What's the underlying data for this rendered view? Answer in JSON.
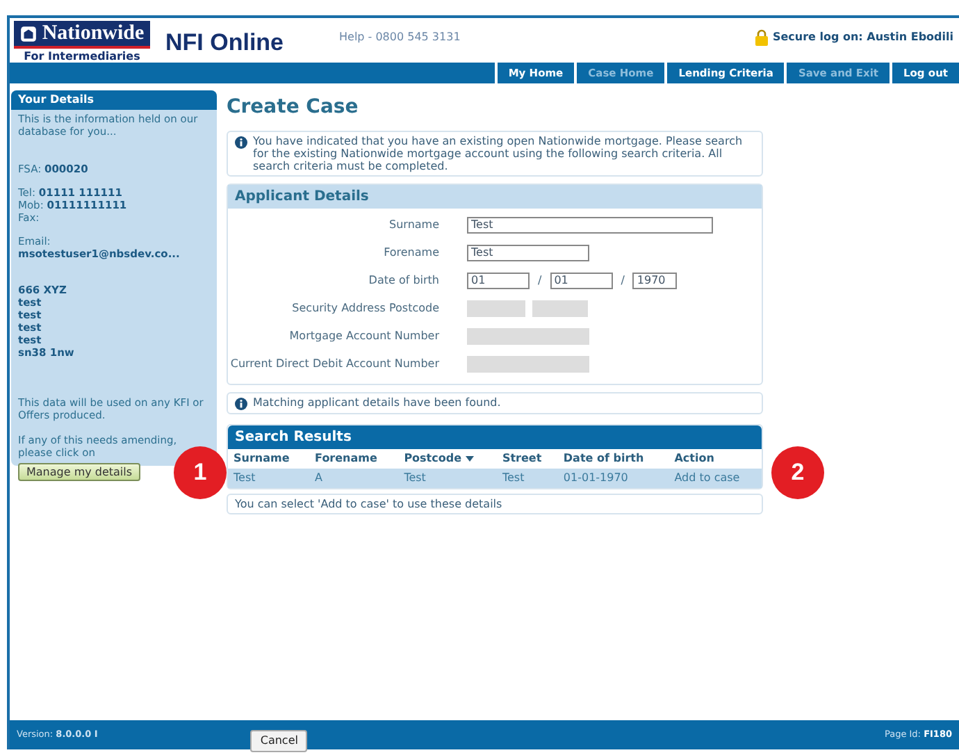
{
  "header": {
    "brand": "Nationwide",
    "subbrand": "For Intermediaries",
    "product": "NFI Online",
    "help": "Help - 0800 545 3131",
    "secure": "Secure log on: Austin Ebodili"
  },
  "nav": [
    {
      "label": "My Home",
      "disabled": false
    },
    {
      "label": "Case Home",
      "disabled": true
    },
    {
      "label": "Lending Criteria",
      "disabled": false
    },
    {
      "label": "Save and Exit",
      "disabled": true
    },
    {
      "label": "Log out",
      "disabled": false
    }
  ],
  "sidebar": {
    "title": "Your Details",
    "intro": "This is the information held on our database for you...",
    "groups": [
      [
        {
          "label": "FSA:",
          "value": "000020"
        }
      ],
      [
        {
          "label": "Tel:",
          "value": "01111 111111"
        },
        {
          "label": "Mob:",
          "value": "01111111111"
        },
        {
          "label": "Fax:"
        }
      ],
      [
        {
          "label": "Email:"
        },
        {
          "value": "msotestuser1@nbsdev.co..."
        }
      ]
    ],
    "address": [
      "666 XYZ",
      "test",
      "test",
      "test",
      "test",
      "sn38 1nw"
    ],
    "note": "This data will be used on any KFI or Offers produced.",
    "amend": "If any of this needs amending, please click on",
    "button": "Manage my details"
  },
  "main": {
    "title": "Create Case",
    "info": "You have indicated that you have an existing open Nationwide mortgage. Please search for the existing Nationwide mortgage account using the following search criteria. All search criteria must be completed.",
    "applicant": {
      "title": "Applicant Details",
      "fields": [
        {
          "label": "Surname",
          "kind": "text",
          "inputs": [
            {
              "value": "Test",
              "disabled": false
            }
          ]
        },
        {
          "label": "Forename",
          "kind": "text",
          "inputs": [
            {
              "value": "Test",
              "disabled": false
            }
          ]
        },
        {
          "label": "Date of birth",
          "kind": "date",
          "separator": "/",
          "inputs": [
            {
              "value": "01",
              "disabled": false
            },
            {
              "value": "01",
              "disabled": false
            },
            {
              "value": "1970",
              "disabled": false
            }
          ]
        },
        {
          "label": "Security Address Postcode",
          "kind": "postcode",
          "inputs": [
            {
              "disabled": true
            },
            {
              "disabled": true
            }
          ]
        },
        {
          "label": "Mortgage Account Number",
          "kind": "text",
          "inputs": [
            {
              "disabled": true
            }
          ]
        },
        {
          "label": "Current Direct Debit Account Number",
          "kind": "text",
          "inputs": [
            {
              "disabled": true
            }
          ]
        }
      ]
    },
    "match": "Matching applicant details have been found.",
    "results": {
      "title": "Search Results",
      "columns": [
        {
          "label": "Surname",
          "sortable": false
        },
        {
          "label": "Forename",
          "sortable": false
        },
        {
          "label": "Postcode",
          "sortable": true
        },
        {
          "label": "Street",
          "sortable": false
        },
        {
          "label": "Date of birth",
          "sortable": false
        },
        {
          "label": "Action",
          "sortable": false
        }
      ],
      "rows": [
        {
          "cells": [
            "Test",
            "A",
            "Test",
            "Test",
            "01-01-1970",
            "Add to case"
          ],
          "selected": true
        }
      ]
    },
    "hint": "You can select 'Add to case' to use these details"
  },
  "footer": {
    "version_label": "Version:",
    "version": "8.0.0.0 I",
    "cancel": "Cancel",
    "page_label": "Page Id:",
    "page": "FI180"
  },
  "callouts": [
    {
      "label": "1"
    },
    {
      "label": "2"
    }
  ]
}
